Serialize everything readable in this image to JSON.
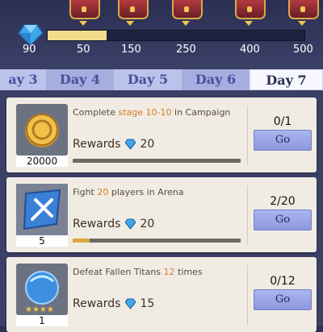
{
  "milestones": {
    "start_value": "90",
    "labels": [
      "50",
      "150",
      "250",
      "400",
      "500"
    ],
    "progress_fraction": 0.23
  },
  "tabs": [
    "ay 3",
    "Day 4",
    "Day 5",
    "Day 6",
    "Day 7"
  ],
  "active_tab": "Day 7",
  "quests": [
    {
      "desc_pre": "Complete ",
      "desc_hl": "stage 10-10",
      "desc_post": " in Campaign",
      "rewards_label": "Rewards",
      "reward_value": "20",
      "reward_count": "20000",
      "progress": "0/1",
      "progress_fraction": 0,
      "go_label": "Go",
      "icon": "gold-coin-icon"
    },
    {
      "desc_pre": "Fight ",
      "desc_hl": "20",
      "desc_post": " players in Arena",
      "rewards_label": "Rewards",
      "reward_value": "20",
      "reward_count": "5",
      "progress": "2/20",
      "progress_fraction": 0.1,
      "go_label": "Go",
      "icon": "arena-scroll-icon"
    },
    {
      "desc_pre": "Defeat Fallen Titans ",
      "desc_hl": "12",
      "desc_post": " times",
      "rewards_label": "Rewards",
      "reward_value": "15",
      "reward_count": "1",
      "progress": "0/12",
      "progress_fraction": 0,
      "go_label": "Go",
      "icon": "crystal-orb-icon"
    }
  ],
  "colors": {
    "accent": "#d47a2a",
    "track_fill": "#f2dc8c",
    "go_button": "#98a4e4"
  }
}
